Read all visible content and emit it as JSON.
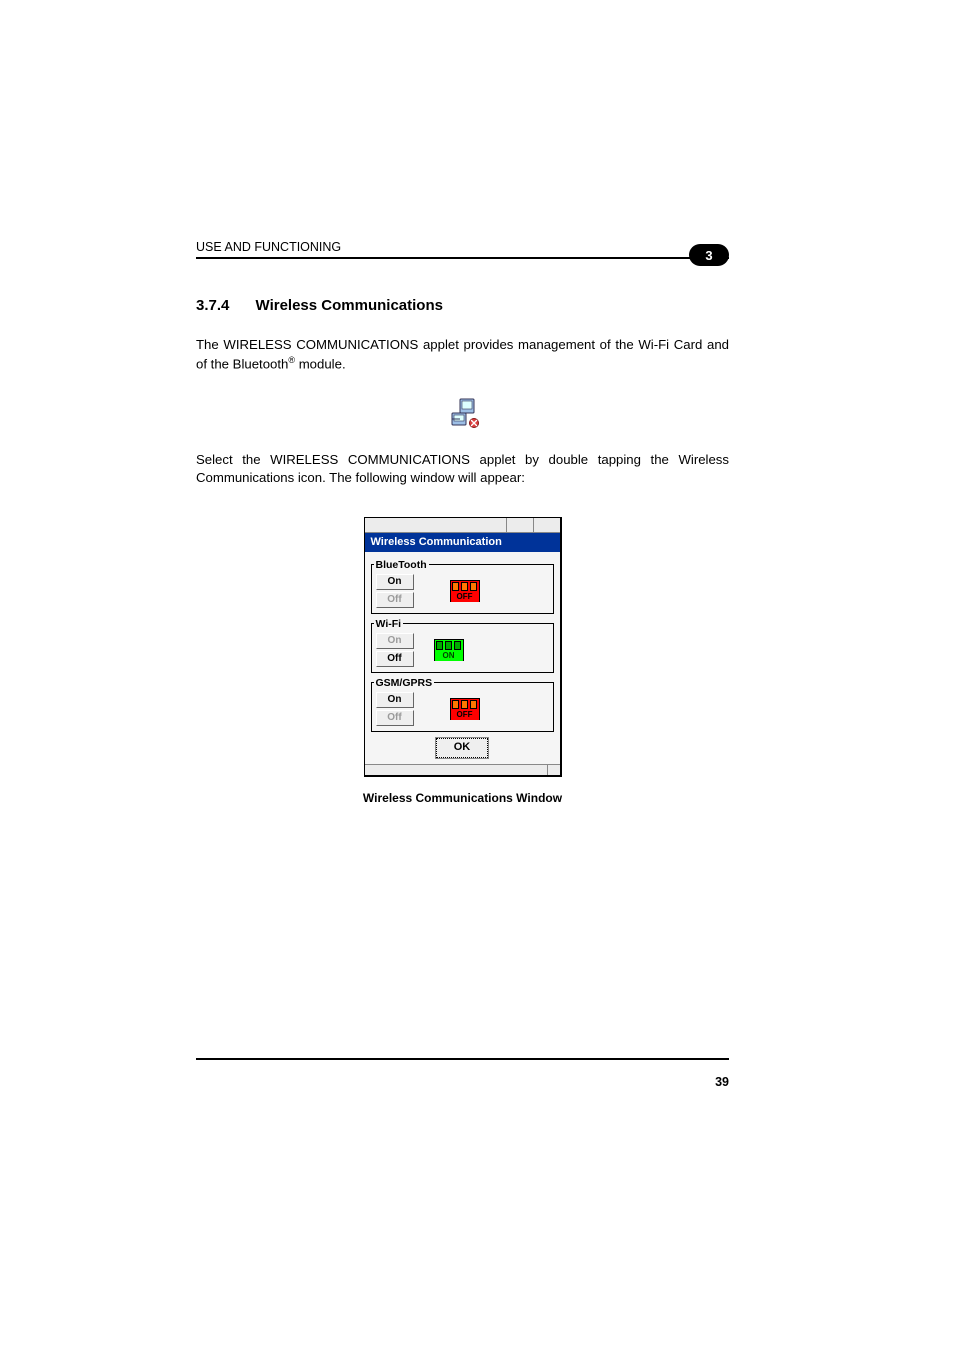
{
  "header": {
    "left": "USE AND FUNCTIONING",
    "badge": "3"
  },
  "section": {
    "number": "3.7.4",
    "title": "Wireless Communications"
  },
  "para1a": "The WIRELESS COMMUNICATIONS applet provides management of the Wi-Fi Card and of the Bluetooth",
  "para1b": " module.",
  "para2": "Select the WIRELESS COMMUNICATIONS applet by double tapping the Wireless Communications icon. The following window will appear:",
  "dialog": {
    "title": "Wireless Communication",
    "groups": {
      "bluetooth": {
        "legend": "BlueTooth",
        "on": "On",
        "off": "Off",
        "state": "off",
        "indLabel": "OFF"
      },
      "wifi": {
        "legend": "Wi-Fi",
        "on": "On",
        "off": "Off",
        "state": "on",
        "indLabel": "ON"
      },
      "gsm": {
        "legend": "GSM/GPRS",
        "on": "On",
        "off": "Off",
        "state": "off",
        "indLabel": "OFF"
      }
    },
    "ok": "OK"
  },
  "caption": "Wireless Communications Window",
  "pageNumber": "39"
}
